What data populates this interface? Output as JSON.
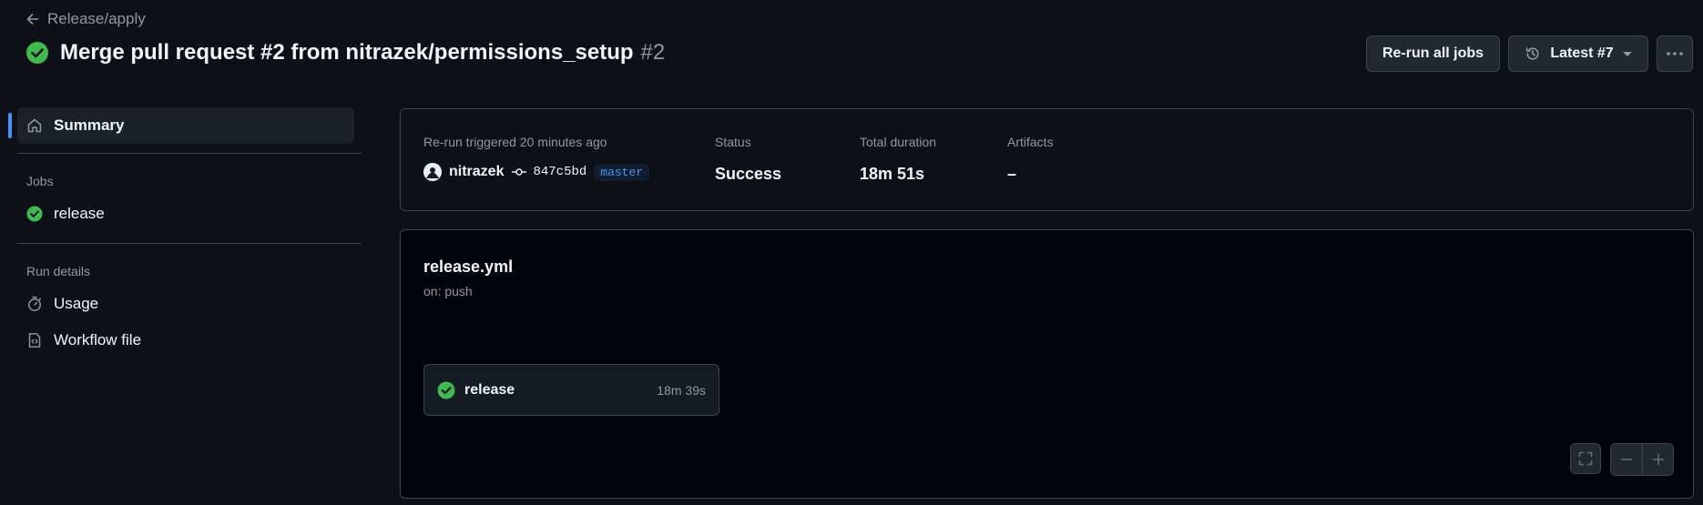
{
  "header": {
    "back_label": "Release/apply",
    "run_title": "Merge pull request #2 from nitrazek/permissions_setup",
    "run_number": "#2",
    "rerun_button": "Re-run all jobs",
    "attempt_button": "Latest #7"
  },
  "sidebar": {
    "summary_label": "Summary",
    "jobs_heading": "Jobs",
    "jobs": [
      {
        "label": "release",
        "status": "success"
      }
    ],
    "run_details_heading": "Run details",
    "run_details": [
      {
        "label": "Usage",
        "icon": "stopwatch-icon"
      },
      {
        "label": "Workflow file",
        "icon": "file-code-icon"
      }
    ]
  },
  "summary": {
    "trigger_label": "Re-run triggered 20 minutes ago",
    "actor": "nitrazek",
    "commit_sha": "847c5bd",
    "branch": "master",
    "status_label": "Status",
    "status_value": "Success",
    "duration_label": "Total duration",
    "duration_value": "18m 51s",
    "artifacts_label": "Artifacts",
    "artifacts_value": "–"
  },
  "workflow": {
    "file_name": "release.yml",
    "trigger": "on: push",
    "jobs": [
      {
        "name": "release",
        "duration": "18m 39s",
        "status": "success"
      }
    ]
  },
  "colors": {
    "background": "#0d1117",
    "success": "#3fb950",
    "accent": "#4493f8",
    "border": "#3d444d"
  }
}
